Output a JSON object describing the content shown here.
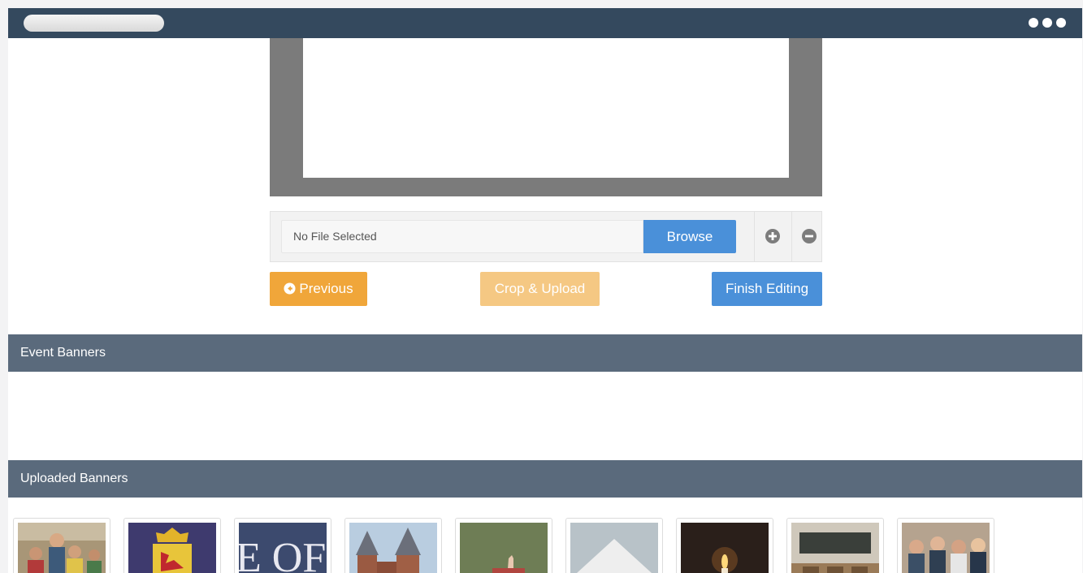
{
  "file_upload": {
    "status_text": "No File Selected",
    "browse_label": "Browse"
  },
  "actions": {
    "previous_label": "Previous",
    "crop_upload_label": "Crop & Upload",
    "finish_label": "Finish Editing"
  },
  "sections": {
    "event_banners_title": "Event Banners",
    "uploaded_banners_title": "Uploaded Banners"
  },
  "thumbnails": [
    {
      "name": "students-photo",
      "text": ""
    },
    {
      "name": "crest-photo",
      "text": ""
    },
    {
      "name": "sign-photo",
      "text": "E OF"
    },
    {
      "name": "church-photo",
      "text": ""
    },
    {
      "name": "classroom-hand-photo",
      "text": ""
    },
    {
      "name": "tent-photo",
      "text": ""
    },
    {
      "name": "candle-photo",
      "text": ""
    },
    {
      "name": "empty-classroom-photo",
      "text": ""
    },
    {
      "name": "group-photo",
      "text": ""
    }
  ],
  "colors": {
    "titlebar": "#34495e",
    "section_header": "#5a6a7c",
    "primary": "#4a90d9",
    "warning": "#f0a63a",
    "warning_disabled": "#f5c883"
  }
}
